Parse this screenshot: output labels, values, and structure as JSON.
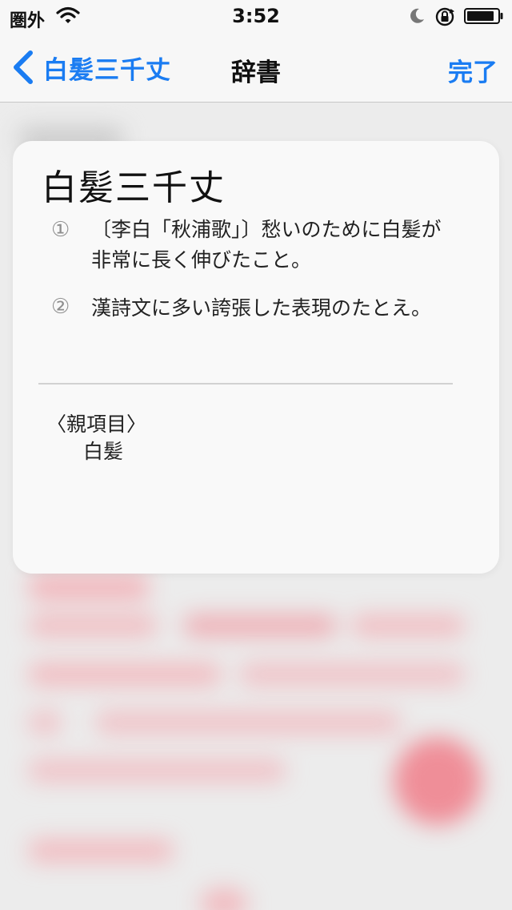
{
  "status_bar": {
    "carrier": "圏外",
    "time": "3:52",
    "icons": [
      "wifi-icon",
      "moon-icon",
      "orientation-lock-icon",
      "battery-icon"
    ]
  },
  "nav": {
    "back_label": "白髪三千丈",
    "title": "辞書",
    "done_label": "完了"
  },
  "card": {
    "headword": "白髪三千丈",
    "definitions": [
      {
        "number": "①",
        "text_line1": "〔李白「秋浦歌」〕愁いのために白髪が",
        "text_line2": "非常に長く伸びたこと。"
      },
      {
        "number": "②",
        "text_line1": "漢詩文に多い誇張した表現のたとえ。"
      }
    ],
    "parent_label": "〈親項目〉",
    "parent_value": "白髪"
  },
  "colors": {
    "accent": "#1a7cf2",
    "card_bg": "#f9f9f9",
    "bar_bg": "#f7f7f7"
  }
}
